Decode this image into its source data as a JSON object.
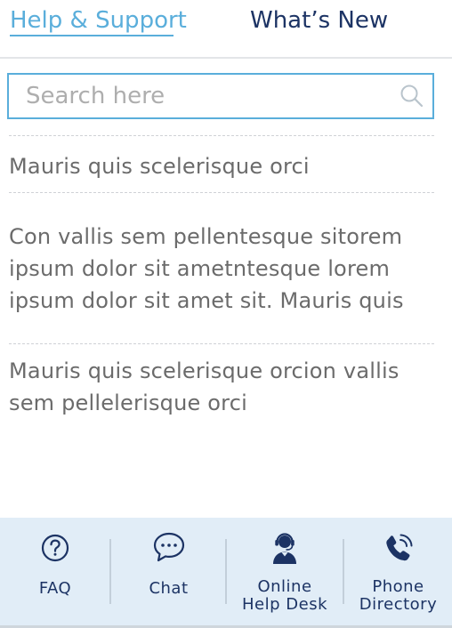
{
  "tabs": [
    {
      "label": "Help & Support",
      "active": true
    },
    {
      "label": "What’s New",
      "active": false
    }
  ],
  "search": {
    "placeholder": "Search here",
    "value": ""
  },
  "articles": [
    {
      "text": "Mauris quis scelerisque orci"
    },
    {
      "text": "Con vallis sem pellentesque sitorem ipsum dolor sit ametntesque lorem ipsum dolor sit amet sit. Mauris quis"
    },
    {
      "text": "Mauris quis scelerisque orcion vallis sem pellelerisque orci"
    }
  ],
  "bottom_nav": [
    {
      "label": "FAQ",
      "icon": "question-circle-icon"
    },
    {
      "label": "Chat",
      "icon": "chat-bubble-icon"
    },
    {
      "label_line1": "Online",
      "label_line2": "Help Desk",
      "icon": "headset-agent-icon"
    },
    {
      "label_line1": "Phone",
      "label_line2": "Directory",
      "icon": "phone-ringing-icon"
    }
  ],
  "colors": {
    "accent": "#5aaedb",
    "navy": "#1c3364",
    "text_gray": "#6b6b6b",
    "nav_background": "#e1edf7"
  }
}
